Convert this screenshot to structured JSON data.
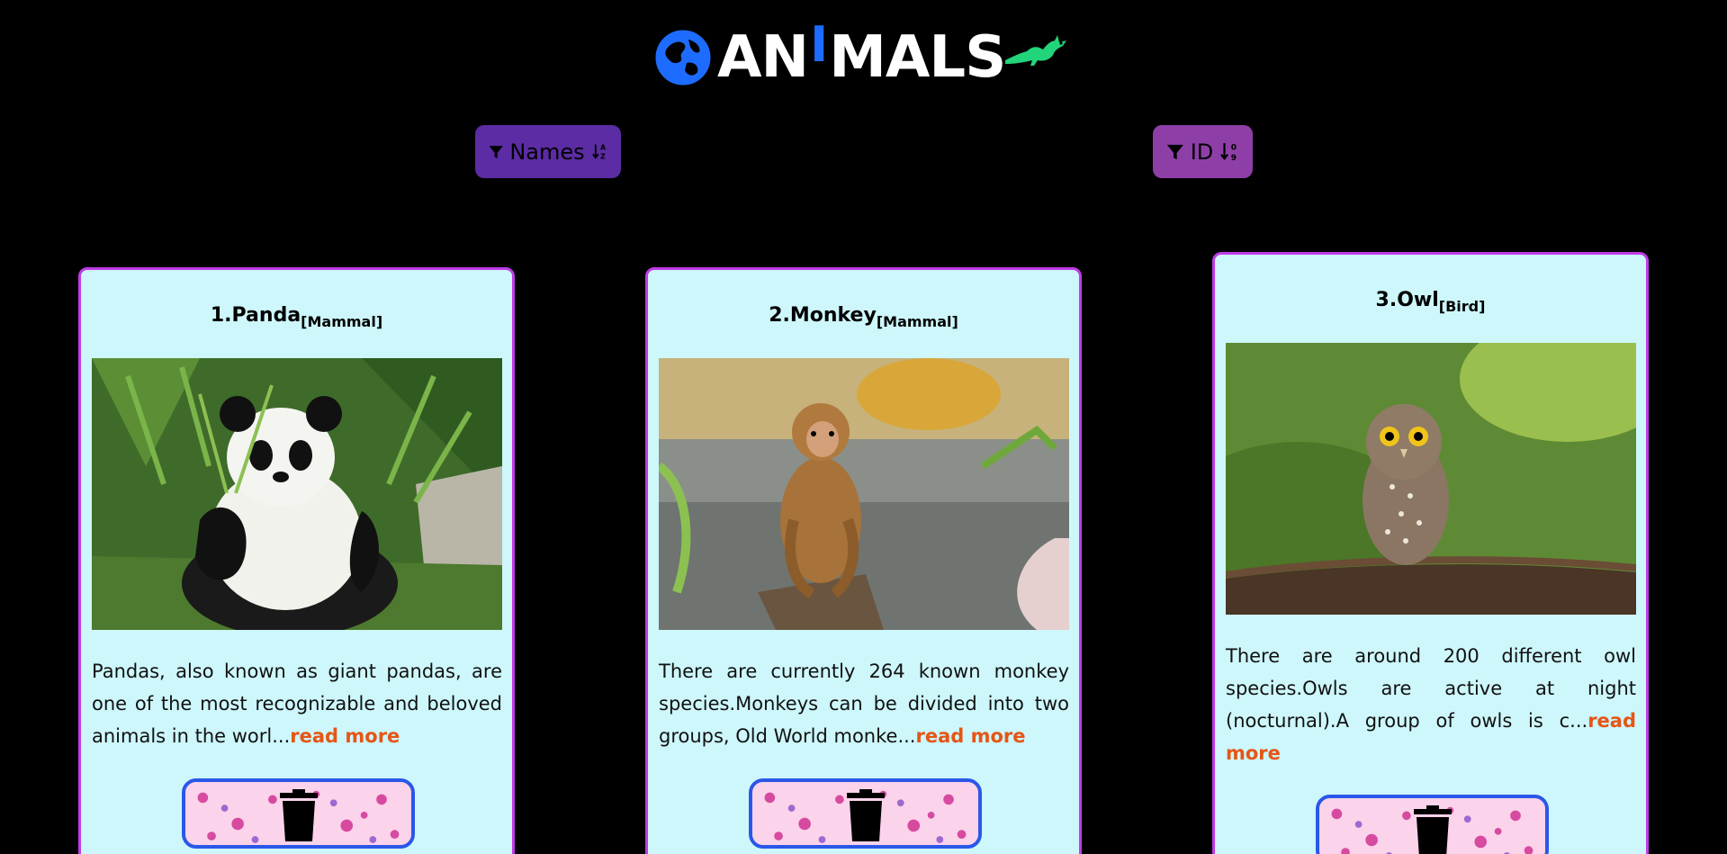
{
  "header": {
    "logo_text_left": "AN",
    "logo_text_bar": "I",
    "logo_text_right": "MALS",
    "logo_globe_icon": "globe-icon",
    "logo_dino_icon": "dinosaur-icon"
  },
  "sort": {
    "names_label": "Names",
    "names_sort_icon": "sort-alpha-down-icon",
    "id_label": "ID",
    "id_sort_icon": "sort-numeric-down-icon",
    "filter_icon": "filter-icon"
  },
  "colors": {
    "background": "#000000",
    "card_background": "#cdf7fb",
    "card_border": "#c03ce6",
    "read_more": "#e65516",
    "names_button": "#5b2ca3",
    "id_button": "#8e3fa7",
    "delete_border": "#2a57e8",
    "logo_blue": "#1e6cff",
    "logo_green": "#22d47a"
  },
  "cards": [
    {
      "title": "1.Panda",
      "category": "[Mammal]",
      "image_icon": "panda-photo",
      "description": "Pandas, also known as giant pandas, are one of the most recognizable and beloved animals in the worl...",
      "read_more": "read more",
      "delete_icon": "trash-icon"
    },
    {
      "title": "2.Monkey",
      "category": "[Mammal]",
      "image_icon": "monkey-photo",
      "description": "There are currently 264 known monkey species.Monkeys can be divided into two groups, Old World monke...",
      "read_more": "read more",
      "delete_icon": "trash-icon"
    },
    {
      "title": "3.Owl",
      "category": "[Bird]",
      "image_icon": "owl-photo",
      "description": "There are around 200 different owl species.Owls are active at night (nocturnal).A group of owls is c...",
      "read_more": "read more",
      "delete_icon": "trash-icon"
    }
  ]
}
